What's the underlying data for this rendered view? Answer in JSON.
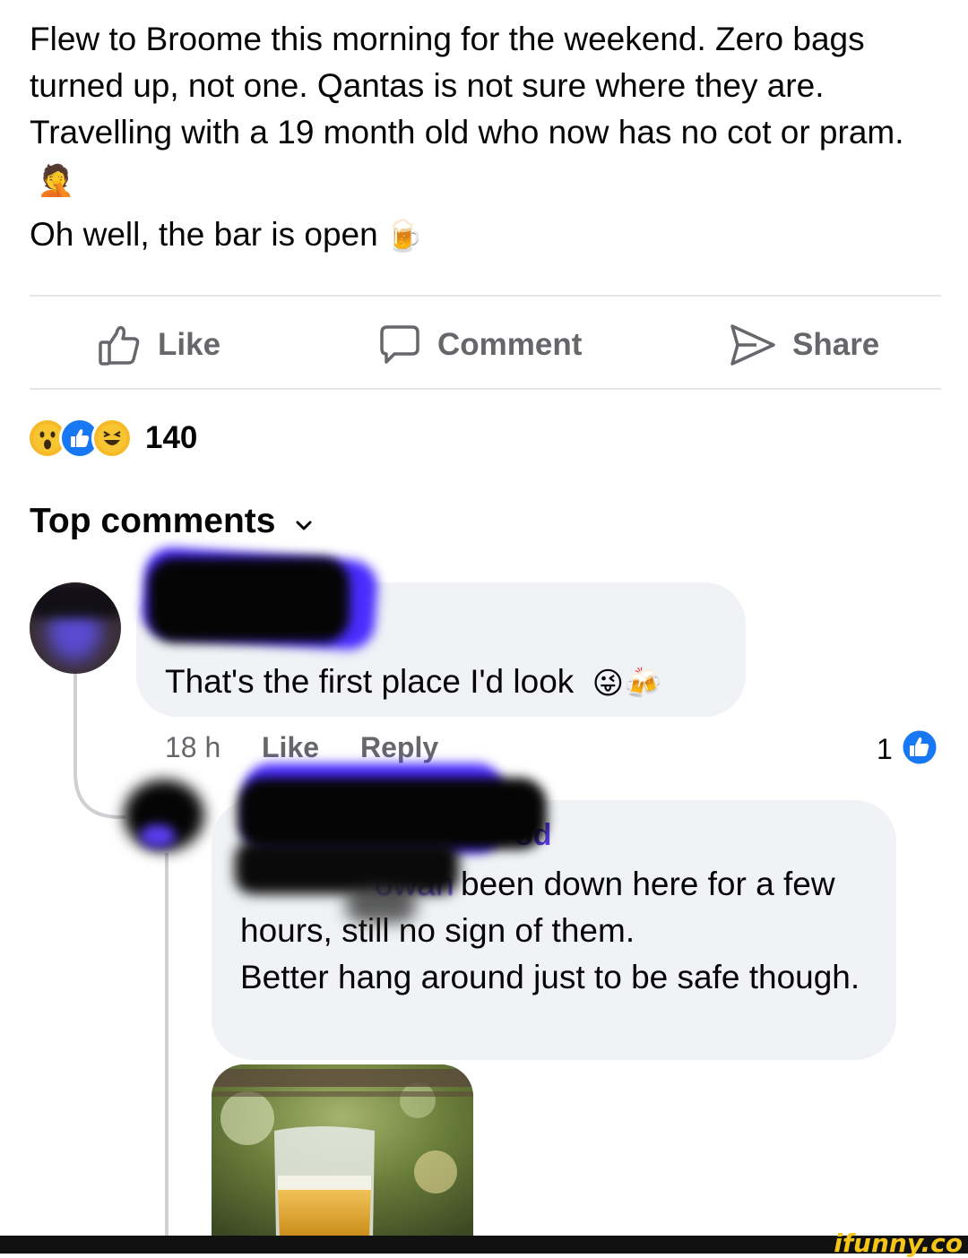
{
  "post": {
    "text_line1": "Flew to Broome this morning for the weekend. Zero bags turned up, not one. Qantas is not sure where they are. Travelling with a 19 month old who now has no cot or pram.",
    "emoji1": "🤦",
    "text_line2": "Oh well, the bar is open",
    "emoji2": "🍺"
  },
  "actions": {
    "like": "Like",
    "comment": "Comment",
    "share": "Share"
  },
  "reactions": {
    "icons": [
      "wow-emoji",
      "like-icon",
      "haha-emoji"
    ],
    "count": "140"
  },
  "comments_header": {
    "label": "Top comments"
  },
  "comment1": {
    "text": "That's the first place I'd look",
    "emojis": "😜🍻",
    "time": "18 h",
    "like": "Like",
    "reply": "Reply",
    "like_count": "1"
  },
  "reply1": {
    "name_fragment": "od",
    "mention_fragment": "owan",
    "text_start": "been down here for a few",
    "text_rest": "hours, still no sign of them.",
    "text_line3": "Better hang around just to be safe though."
  },
  "watermark": {
    "brand": "ifunny.co",
    "brand_color": "#f5c518"
  },
  "colors": {
    "facebook_blue": "#1877f2",
    "secondary_text": "#65676b",
    "bubble_bg": "#f0f2f5",
    "redaction_purple": "#4b2cff"
  }
}
